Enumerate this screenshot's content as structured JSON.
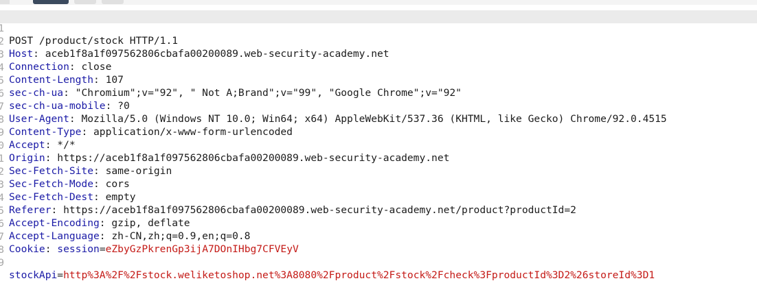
{
  "request": {
    "request_line": "POST /product/stock HTTP/1.1",
    "headers": [
      {
        "name": "Host",
        "value": "aceb1f8a1f097562806cbafa00200089.web-security-academy.net"
      },
      {
        "name": "Connection",
        "value": "close"
      },
      {
        "name": "Content-Length",
        "value": "107"
      },
      {
        "name": "sec-ch-ua",
        "value": "\"Chromium\";v=\"92\", \" Not A;Brand\";v=\"99\", \"Google Chrome\";v=\"92\""
      },
      {
        "name": "sec-ch-ua-mobile",
        "value": "?0"
      },
      {
        "name": "User-Agent",
        "value": "Mozilla/5.0 (Windows NT 10.0; Win64; x64) AppleWebKit/537.36 (KHTML, like Gecko) Chrome/92.0.4515"
      },
      {
        "name": "Content-Type",
        "value": "application/x-www-form-urlencoded"
      },
      {
        "name": "Accept",
        "value": "*/*"
      },
      {
        "name": "Origin",
        "value": "https://aceb1f8a1f097562806cbafa00200089.web-security-academy.net"
      },
      {
        "name": "Sec-Fetch-Site",
        "value": "same-origin"
      },
      {
        "name": "Sec-Fetch-Mode",
        "value": "cors"
      },
      {
        "name": "Sec-Fetch-Dest",
        "value": "empty"
      },
      {
        "name": "Referer",
        "value": "https://aceb1f8a1f097562806cbafa00200089.web-security-academy.net/product?productId=2"
      },
      {
        "name": "Accept-Encoding",
        "value": "gzip, deflate"
      },
      {
        "name": "Accept-Language",
        "value": "zh-CN,zh;q=0.9,en;q=0.8"
      }
    ],
    "cookie": {
      "name": "Cookie",
      "key": "session",
      "value": "eZbyGzPkrenGp3ijA7DOnIHbg7CFVEyV"
    },
    "body": {
      "param": "stockApi",
      "value": "http%3A%2F%2Fstock.weliketoshop.net%3A8080%2Fproduct%2Fstock%2Fcheck%3FproductId%3D2%26storeId%3D1"
    }
  },
  "line_numbers": [
    "1",
    "2",
    "3",
    "4",
    "5",
    "6",
    "7",
    "8",
    "9",
    "0",
    "1",
    "2",
    "3",
    "4",
    "5",
    "6",
    "7",
    "8",
    "9"
  ],
  "colors": {
    "header_name": "#1a1aa6",
    "cookie_value": "#c41a16",
    "text": "#1b1b1b",
    "line_number": "#a6a6a6"
  }
}
